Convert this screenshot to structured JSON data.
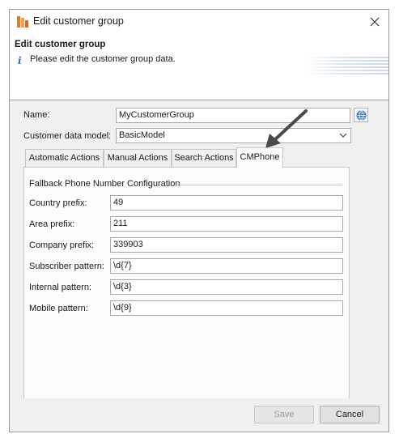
{
  "window": {
    "title": "Edit customer group",
    "close_icon": "close-icon"
  },
  "banner": {
    "title": "Edit customer group",
    "subtitle": "Please edit the customer group data.",
    "info_glyph": "i"
  },
  "form": {
    "name_label": "Name:",
    "name_value": "MyCustomerGroup",
    "model_label": "Customer data model:",
    "model_value": "BasicModel"
  },
  "tabs": [
    {
      "label": "Automatic Actions"
    },
    {
      "label": "Manual Actions"
    },
    {
      "label": "Search Actions"
    },
    {
      "label": "CMPhone",
      "active": true
    }
  ],
  "group": {
    "title": "Fallback Phone Number Configuration",
    "fields": [
      {
        "label": "Country prefix:",
        "value": "49"
      },
      {
        "label": "Area prefix:",
        "value": "211"
      },
      {
        "label": "Company prefix:",
        "value": "339903"
      },
      {
        "label": "Subscriber pattern:",
        "value": "\\d{7}"
      },
      {
        "label": "Internal pattern:",
        "value": "\\d{3}"
      },
      {
        "label": "Mobile pattern:",
        "value": "\\d{9}"
      }
    ]
  },
  "footer": {
    "save_label": "Save",
    "cancel_label": "Cancel"
  },
  "colors": {
    "info": "#2a6ad8",
    "annotation_arrow": "#4a4a4a"
  }
}
